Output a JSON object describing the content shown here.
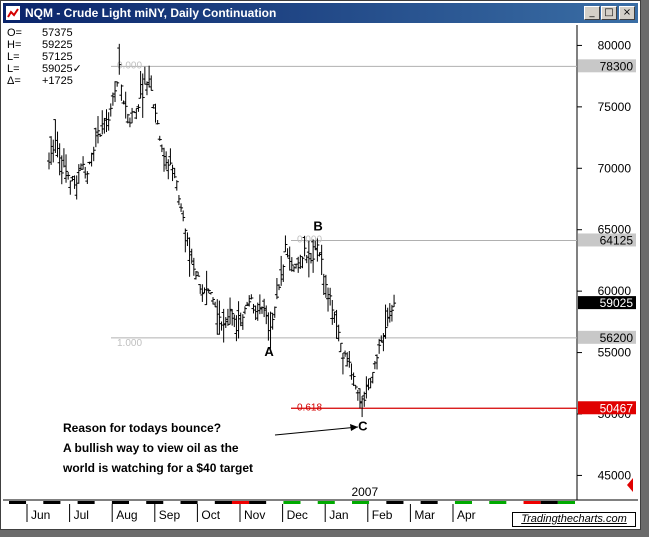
{
  "window": {
    "title": "NQM - Crude Light miNY, Daily Continuation",
    "controls": {
      "minimize": "_",
      "maximize": "□",
      "close": "×"
    }
  },
  "ohlc": [
    {
      "label": "O=",
      "value": "57375"
    },
    {
      "label": "H=",
      "value": "59225"
    },
    {
      "label": "L=",
      "value": "57125"
    },
    {
      "label": "L=",
      "value": "59025✓"
    },
    {
      "label": "Δ=",
      "value": "+1725"
    }
  ],
  "chart_data": {
    "type": "bar",
    "title": "NQM - Crude Light miNY, Daily Continuation",
    "y_range": [
      43000,
      81500
    ],
    "y_ticks": [
      45000,
      50000,
      55000,
      60000,
      65000,
      70000,
      75000,
      80000
    ],
    "x_ticks": [
      "Jun",
      "Jul",
      "Aug",
      "Sep",
      "Oct",
      "Nov",
      "Dec",
      "Jan",
      "Feb",
      "Mar",
      "Apr"
    ],
    "year_label": "2007",
    "price_boxes": [
      {
        "label": "78300",
        "value": 78300,
        "style": "gray"
      },
      {
        "label": "64125",
        "value": 64125,
        "style": "gray"
      },
      {
        "label": "59025",
        "value": 59025,
        "style": "black"
      },
      {
        "label": "56200",
        "value": 56200,
        "style": "gray"
      },
      {
        "label": "50467",
        "value": 50467,
        "style": "red"
      }
    ],
    "fib_lines": [
      {
        "label": "0.000",
        "value": 78300
      },
      {
        "label": "0.000",
        "value": 64125
      },
      {
        "label": "1.000",
        "value": 56200
      },
      {
        "label": "0.618",
        "value": 50467
      }
    ],
    "wave_labels": [
      {
        "text": "A",
        "value": 55400,
        "month_index": 5.15
      },
      {
        "text": "B",
        "value": 65200,
        "month_index": 6.3
      },
      {
        "text": "C",
        "value": 50000,
        "month_index": 7.35
      }
    ],
    "closes_path": [
      [
        0,
        70500
      ],
      [
        0.15,
        72500
      ],
      [
        0.3,
        70000
      ],
      [
        0.45,
        69500
      ],
      [
        0.6,
        68500
      ],
      [
        0.75,
        70500
      ],
      [
        0.9,
        69500
      ],
      [
        1.0,
        71500
      ],
      [
        1.2,
        73000
      ],
      [
        1.4,
        74000
      ],
      [
        1.55,
        76500
      ],
      [
        1.65,
        78000
      ],
      [
        1.75,
        75500
      ],
      [
        1.9,
        74000
      ],
      [
        2.05,
        75000
      ],
      [
        2.2,
        76000
      ],
      [
        2.35,
        77500
      ],
      [
        2.45,
        75000
      ],
      [
        2.55,
        73500
      ],
      [
        2.7,
        71000
      ],
      [
        2.85,
        70500
      ],
      [
        3.0,
        68500
      ],
      [
        3.15,
        66000
      ],
      [
        3.3,
        63000
      ],
      [
        3.45,
        61500
      ],
      [
        3.6,
        60000
      ],
      [
        3.8,
        59500
      ],
      [
        3.95,
        58000
      ],
      [
        4.1,
        57500
      ],
      [
        4.25,
        58500
      ],
      [
        4.4,
        57000
      ],
      [
        4.55,
        58000
      ],
      [
        4.7,
        59500
      ],
      [
        4.85,
        58000
      ],
      [
        5.0,
        59000
      ],
      [
        5.15,
        57000
      ],
      [
        5.3,
        58500
      ],
      [
        5.45,
        61000
      ],
      [
        5.55,
        63500
      ],
      [
        5.7,
        62500
      ],
      [
        5.85,
        62000
      ],
      [
        6.0,
        63500
      ],
      [
        6.15,
        62500
      ],
      [
        6.3,
        64000
      ],
      [
        6.45,
        61500
      ],
      [
        6.6,
        59500
      ],
      [
        6.75,
        57500
      ],
      [
        6.9,
        55000
      ],
      [
        7.05,
        54000
      ],
      [
        7.2,
        52000
      ],
      [
        7.3,
        51200
      ],
      [
        7.4,
        51500
      ],
      [
        7.55,
        53000
      ],
      [
        7.7,
        55000
      ],
      [
        7.85,
        56500
      ],
      [
        8.0,
        58000
      ],
      [
        8.1,
        59025
      ]
    ]
  },
  "annotation": {
    "lines": [
      "Reason for todays bounce?",
      "A bullish way to view oil as the",
      "world is watching for a $40 target"
    ]
  },
  "watermark": "Tradingthecharts.com",
  "colors": {
    "title_bar": "#0a246a",
    "fib_red": "#d40000",
    "fib_gray": "#b0b0b0"
  }
}
